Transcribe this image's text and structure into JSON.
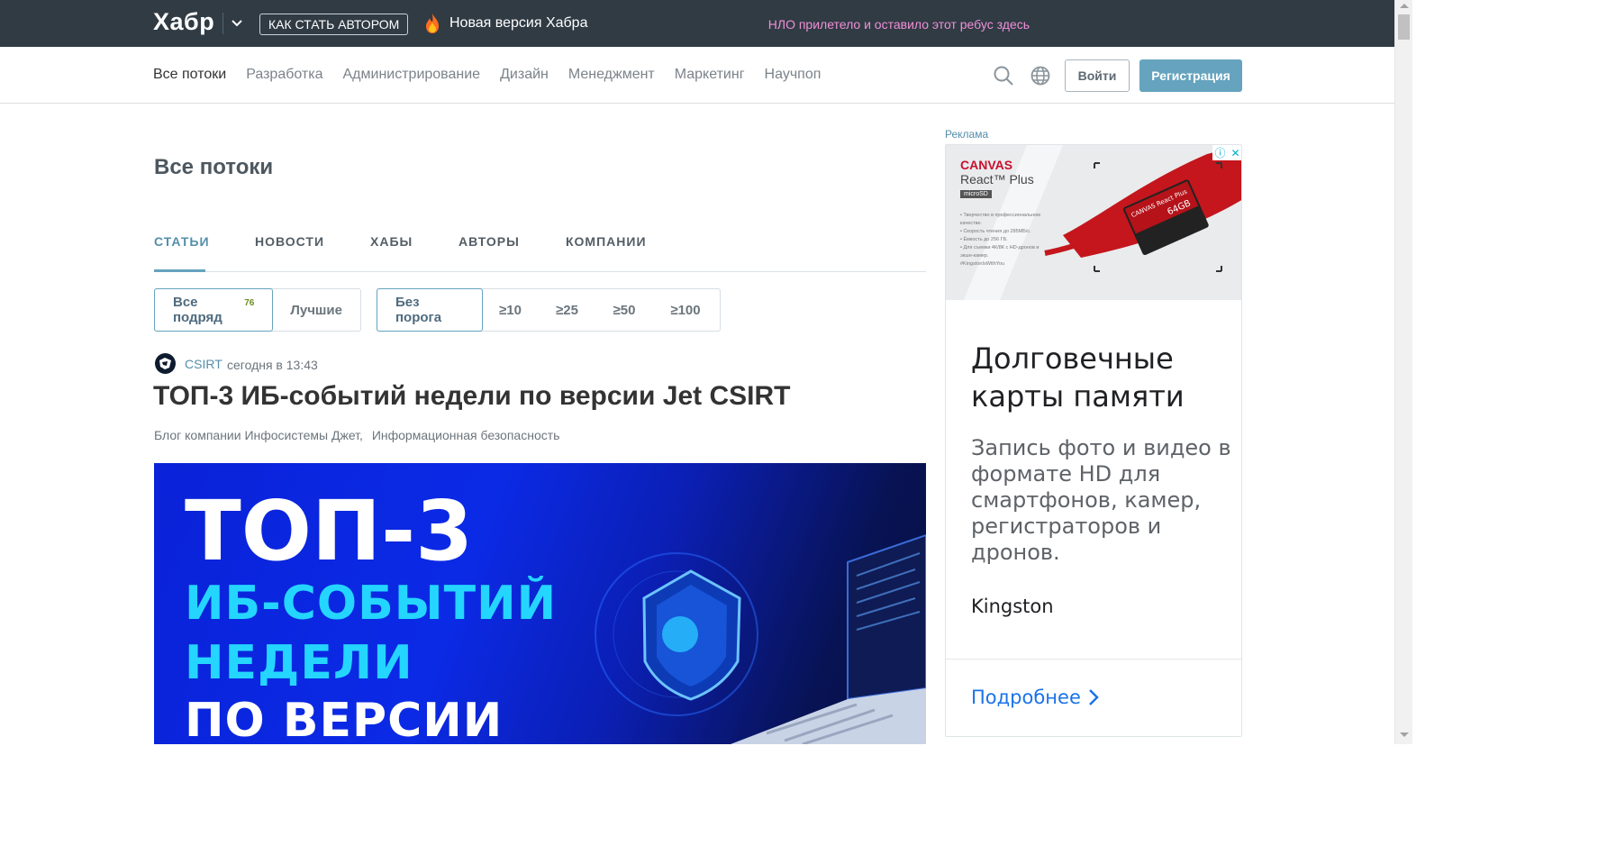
{
  "topbar": {
    "logo": "Хабр",
    "author_button": "КАК СТАТЬ АВТОРОМ",
    "new_version": "Новая версия Хабра",
    "ufo_link": "НЛО прилетело и оставило этот ребус здесь"
  },
  "nav": {
    "items": [
      "Все потоки",
      "Разработка",
      "Администрирование",
      "Дизайн",
      "Менеджмент",
      "Маркетинг",
      "Научпоп"
    ],
    "login": "Войти",
    "register": "Регистрация"
  },
  "page": {
    "title": "Все потоки",
    "tabs": [
      "СТАТЬИ",
      "НОВОСТИ",
      "ХАБЫ",
      "АВТОРЫ",
      "КОМПАНИИ"
    ],
    "filters_rating": {
      "all": "Все подряд",
      "all_count": "76",
      "best": "Лучшие"
    },
    "filters_threshold": [
      "Без порога",
      "≥10",
      "≥25",
      "≥50",
      "≥100"
    ]
  },
  "article": {
    "author": "CSIRT",
    "time": "сегодня в 13:43",
    "title": "ТОП-3 ИБ-событий недели по версии Jet CSIRT",
    "hubs": [
      "Блог компании Инфосистемы Джет,",
      "Информационная безопасность"
    ],
    "banner_lines": [
      "ТОП-3",
      "ИБ-СОБЫТИЙ",
      "НЕДЕЛИ",
      "ПО ВЕРСИИ"
    ]
  },
  "ad": {
    "label": "Реклама",
    "brand": "CANVAS",
    "product": "React™ Plus",
    "micro": "microSD",
    "bullets": [
      "• Творчество в профессиональном качестве.",
      "• Скорость чтения до 285МБ/с.",
      "• Ёмкость до 256 ГБ.",
      "• Для съемки 4К/8К с HD-дронов и экшн-камер.",
      "#KingstonIsWithYou"
    ],
    "card_label": "Kingston CANVAS React Plus 64GB",
    "headline": "Долговечные карты памяти",
    "text": "Запись фото и видео в формате HD для смартфонов, камер, регистраторов и дронов.",
    "advertiser": "Kingston",
    "more": "Подробнее"
  },
  "colors": {
    "topbar": "#303b44",
    "accent": "#65a3be",
    "ufo": "#f08fd6",
    "banner_blue": "#0a22d8",
    "banner_cyan": "#24d6ff"
  }
}
